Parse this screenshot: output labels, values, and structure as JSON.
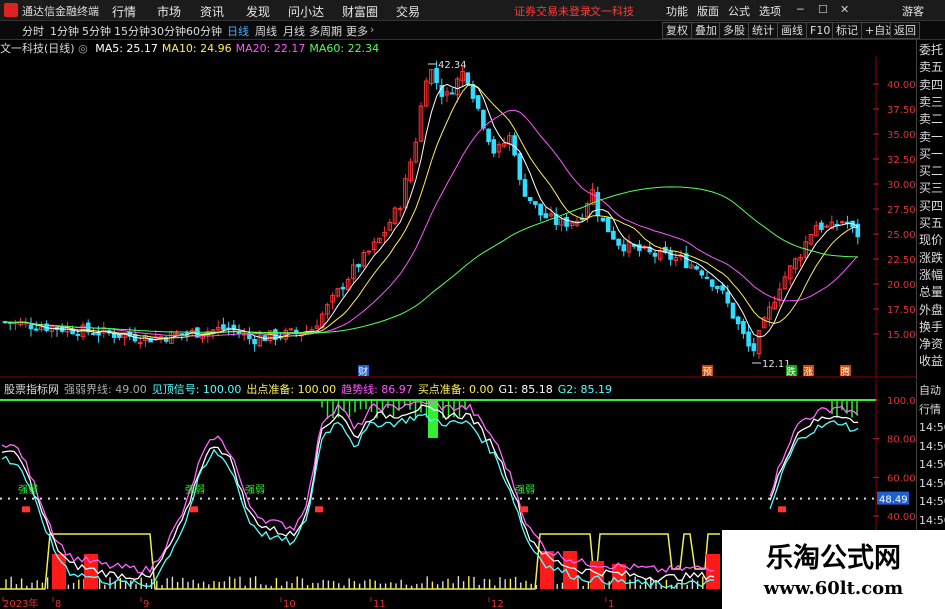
{
  "app": {
    "title": "通达信金融终端"
  },
  "menu": [
    "行情",
    "市场",
    "资讯",
    "发现",
    "问小达",
    "财富圈",
    "交易"
  ],
  "top_links": {
    "login": "证券交易未登录",
    "stock": "文一科技"
  },
  "right_menu": [
    "功能",
    "版面",
    "公式",
    "选项"
  ],
  "guest": "游客",
  "periods": [
    "分时",
    "1分钟",
    "5分钟",
    "15分钟",
    "30分钟",
    "60分钟",
    "日线",
    "周线",
    "月线",
    "多周期",
    "更多"
  ],
  "active_period": "日线",
  "toolbar_right": [
    "复权",
    "叠加",
    "多股",
    "统计",
    "画线",
    "F10",
    "标记",
    "+自选",
    "返回"
  ],
  "chart_title": "文一科技(日线)",
  "ma_labels": [
    {
      "text": "MA5: 25.17",
      "color": "#ffffff"
    },
    {
      "text": "MA10: 24.96",
      "color": "#ffee55"
    },
    {
      "text": "MA20: 22.17",
      "color": "#ff55ff"
    },
    {
      "text": "MA60: 22.34",
      "color": "#55ff55"
    }
  ],
  "price_axis": [
    "40.00",
    "37.50",
    "35.00",
    "32.50",
    "30.00",
    "27.50",
    "25.00",
    "22.50",
    "20.00",
    "17.50",
    "15.00"
  ],
  "price_annotations": {
    "high": "42.34",
    "low": "12.11"
  },
  "event_markers": [
    "财",
    "预",
    "跌",
    "涨",
    "腾"
  ],
  "indicator_header": [
    {
      "text": "股票指标网",
      "color": "#dddddd"
    },
    {
      "text": "强弱界线: 49.00",
      "color": "#aaaaaa"
    },
    {
      "text": "见顶信号: 100.00",
      "color": "#55ffff"
    },
    {
      "text": "出点准备: 100.00",
      "color": "#ffee55"
    },
    {
      "text": "趋势线: 86.97",
      "color": "#ff55ff"
    },
    {
      "text": "买点准备: 0.00",
      "color": "#ffee55"
    },
    {
      "text": "G1: 85.18",
      "color": "#ffffff"
    },
    {
      "text": "G2: 85.19",
      "color": "#55ffff"
    }
  ],
  "indicator_axis": [
    "100.00",
    "80.00",
    "60.00",
    "40.00"
  ],
  "indicator_level": "48.49",
  "indicator_labels": [
    "强弱",
    "强弱",
    "强弱",
    "强弱"
  ],
  "date_axis": [
    "2023年",
    "8",
    "9",
    "10",
    "11",
    "12",
    "1"
  ],
  "side_panel_top": [
    "委托",
    "卖五",
    "卖四",
    "卖三",
    "卖二",
    "卖一",
    "买一",
    "买二",
    "买三",
    "买四",
    "买五",
    "现价",
    "涨跌",
    "涨幅",
    "总量",
    "外盘",
    "换手",
    "净资",
    "收益"
  ],
  "side_panel_bottom": [
    "自动",
    "行情",
    "14:50",
    "14:50",
    "14:50",
    "14:50",
    "14:50",
    "14:50",
    "14:50"
  ],
  "watermark": {
    "title": "乐淘公式网",
    "url": "www.60lt.com"
  }
}
